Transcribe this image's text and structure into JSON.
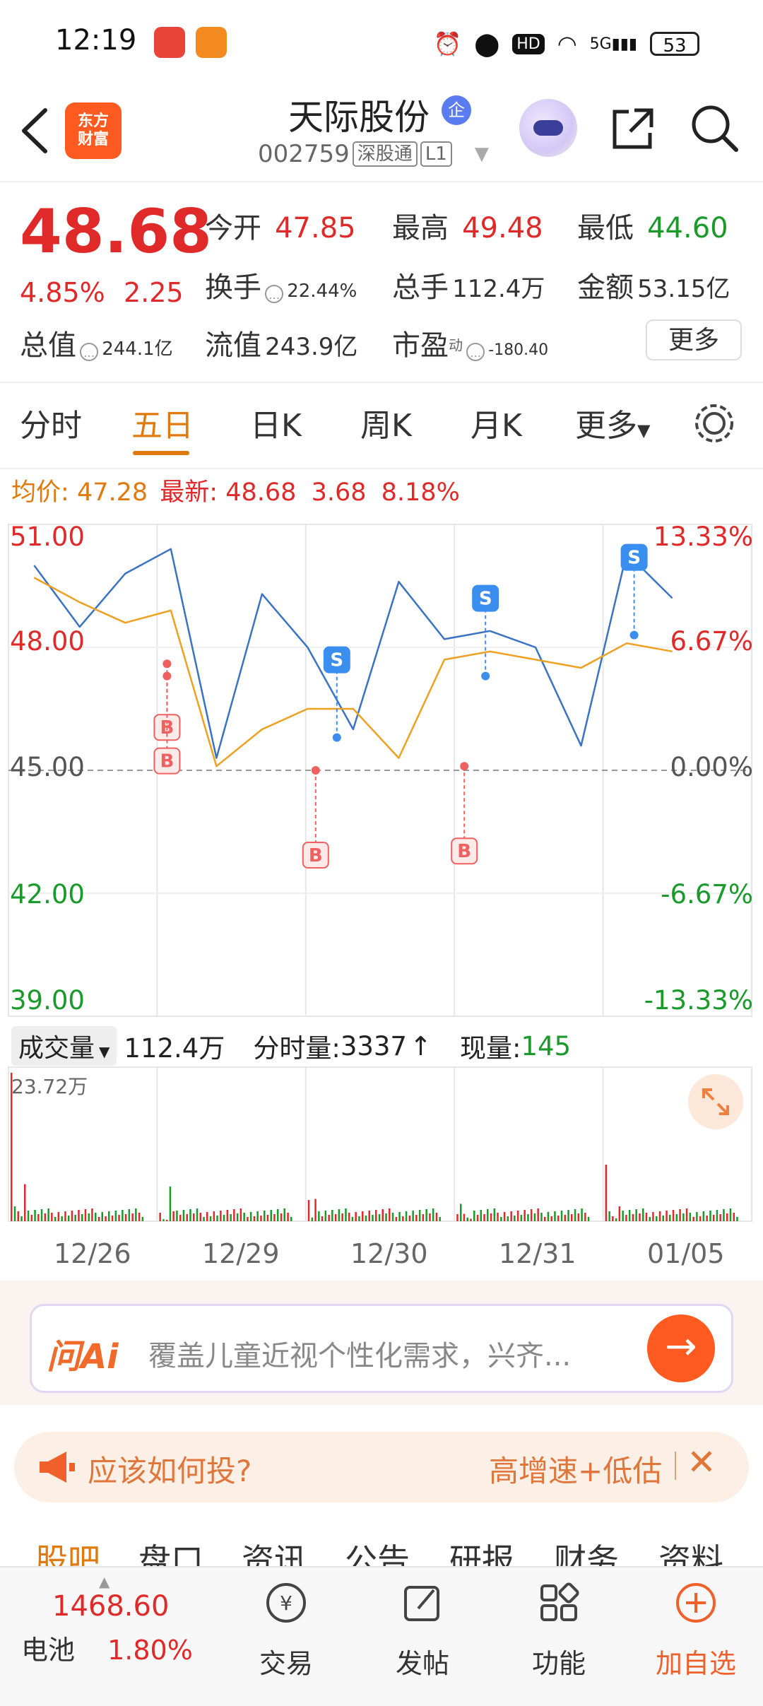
{
  "status_bar": {
    "time": "12:19",
    "battery": "53",
    "network": "5G",
    "icons": [
      "alarm-icon",
      "location-icon",
      "hd-icon",
      "wifi-icon",
      "signal-icon"
    ]
  },
  "header": {
    "logo_line1": "东方",
    "logo_line2": "财富",
    "stock_name": "天际股份",
    "enterprise_badge": "企",
    "stock_code": "002759",
    "connect_tag": "深股通",
    "level_tag": "L1"
  },
  "quote": {
    "last": "48.68",
    "pct": "4.85%",
    "change": "2.25",
    "open_label": "今开",
    "open": "47.85",
    "high_label": "最高",
    "high": "49.48",
    "low_label": "最低",
    "low": "44.60",
    "turnover_label": "换手",
    "turnover": "22.44%",
    "volume_label": "总手",
    "volume": "112.4万",
    "amount_label": "金额",
    "amount": "53.15亿",
    "mktcap_label": "总值",
    "mktcap": "244.1亿",
    "float_label": "流值",
    "float": "243.9亿",
    "pe_label": "市盈",
    "pe_sup": "动",
    "pe": "-180.40",
    "more": "更多"
  },
  "tabs": [
    "分时",
    "五日",
    "日K",
    "周K",
    "月K",
    "更多"
  ],
  "chart_header": {
    "avg_label": "均价:",
    "avg": "47.28",
    "latest_label": "最新:",
    "latest": "48.68",
    "chg": "3.68",
    "chg_pct": "8.18%"
  },
  "chart_data": {
    "type": "line",
    "x": [
      "12/26",
      "12/29",
      "12/30",
      "12/31",
      "01/05"
    ],
    "y_left_ticks": [
      "51.00",
      "48.00",
      "45.00",
      "42.00",
      "39.00"
    ],
    "y_right_ticks": [
      "13.33%",
      "6.67%",
      "0.00%",
      "-6.67%",
      "-13.33%"
    ],
    "ylim": [
      39.0,
      51.0
    ],
    "prev_close": 45.0,
    "series": [
      {
        "values": [
          50.0,
          48.5,
          49.8,
          50.4,
          45.3,
          49.3,
          48.0,
          46.0,
          49.6,
          48.2,
          48.4,
          48.0,
          45.6,
          50.3,
          49.2
        ]
      },
      {
        "values": [
          49.7,
          49.1,
          48.6,
          48.9,
          45.1,
          46.0,
          46.5,
          46.5,
          45.3,
          47.7,
          47.9,
          47.7,
          47.5,
          48.1,
          47.9
        ]
      }
    ],
    "markers": [
      {
        "label": "B",
        "date": "12/29",
        "price": 47.6
      },
      {
        "label": "B",
        "date": "12/29",
        "price": 47.3
      },
      {
        "label": "S",
        "date": "12/30",
        "price": 45.8
      },
      {
        "label": "B",
        "date": "12/30",
        "price": 45.0
      },
      {
        "label": "S",
        "date": "12/31",
        "price": 47.3
      },
      {
        "label": "B",
        "date": "12/31",
        "price": 45.1
      },
      {
        "label": "S",
        "date": "01/05",
        "price": 48.3
      }
    ]
  },
  "volume": {
    "dropdown": "成交量",
    "total": "112.4万",
    "tick_label": "分时量:",
    "tick_value": "3337",
    "current_label": "现量:",
    "current": "145",
    "max_label": "23.72万"
  },
  "ai": {
    "logo": "问Ai",
    "text": "覆盖儿童近视个性化需求，兴齐..."
  },
  "promo": {
    "question": "应该如何投?",
    "tag": "高增速+低估",
    "close": "✕"
  },
  "subtabs": [
    "股吧",
    "盘口",
    "资讯",
    "公告",
    "研报",
    "财务",
    "资料"
  ],
  "bottom_nav": {
    "index_value": "1468.60",
    "index_name": "电池",
    "index_pct": "1.80%",
    "trade": "交易",
    "post": "发帖",
    "features": "功能",
    "add_watch": "加自选"
  },
  "colors": {
    "up": "#e02a2a",
    "down": "#1a9a2a",
    "accent": "#e07a0f",
    "price_line": "#3a73c4",
    "avg_line": "#f0a020"
  }
}
